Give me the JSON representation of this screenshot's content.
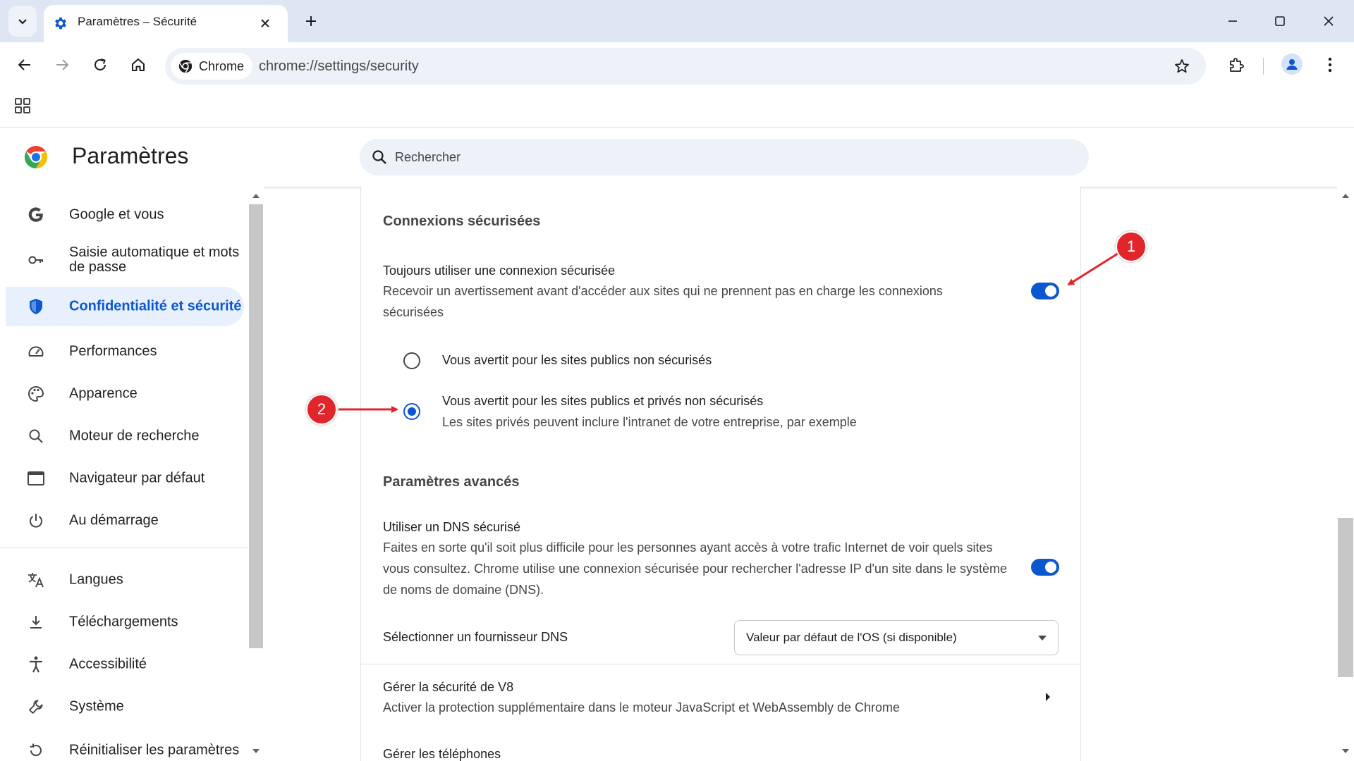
{
  "browser": {
    "tab": {
      "title": "Paramètres – Sécurité",
      "favicon": "gear-icon"
    },
    "omnibox": {
      "chip_label": "Chrome",
      "url": "chrome://settings/security"
    }
  },
  "settings": {
    "title": "Paramètres",
    "search": {
      "placeholder": "Rechercher"
    }
  },
  "sidebar": {
    "items": [
      {
        "label": "Google et vous",
        "icon": "google-g-icon"
      },
      {
        "label": "Saisie automatique et mots de passe",
        "icon": "key-icon"
      },
      {
        "label": "Confidentialité et sécurité",
        "icon": "shield-icon",
        "active": true
      },
      {
        "label": "Performances",
        "icon": "speedometer-icon"
      },
      {
        "label": "Apparence",
        "icon": "palette-icon"
      },
      {
        "label": "Moteur de recherche",
        "icon": "search-icon"
      },
      {
        "label": "Navigateur par défaut",
        "icon": "browser-window-icon"
      },
      {
        "label": "Au démarrage",
        "icon": "power-icon"
      },
      {
        "label": "Langues",
        "icon": "translate-icon"
      },
      {
        "label": "Téléchargements",
        "icon": "download-icon"
      },
      {
        "label": "Accessibilité",
        "icon": "accessibility-icon"
      },
      {
        "label": "Système",
        "icon": "wrench-icon"
      },
      {
        "label": "Réinitialiser les paramètres",
        "icon": "reset-icon"
      }
    ]
  },
  "main": {
    "secure_connections": {
      "heading": "Connexions sécurisées",
      "always_secure": {
        "title": "Toujours utiliser une connexion sécurisée",
        "description": "Recevoir un avertissement avant d'accéder aux sites qui ne prennent pas en charge les connexions sécurisées",
        "enabled": true
      },
      "options": [
        {
          "label": "Vous avertit pour les sites publics non sécurisés",
          "sublabel": "",
          "selected": false
        },
        {
          "label": "Vous avertit pour les sites publics et privés non sécurisés",
          "sublabel": "Les sites privés peuvent inclure l'intranet de votre entreprise, par exemple",
          "selected": true
        }
      ]
    },
    "advanced": {
      "heading": "Paramètres avancés",
      "secure_dns": {
        "title": "Utiliser un DNS sécurisé",
        "description": "Faites en sorte qu'il soit plus difficile pour les personnes ayant accès à votre trafic Internet de voir quels sites vous consultez. Chrome utilise une connexion sécurisée pour rechercher l'adresse IP d'un site dans le système de noms de domaine (DNS).",
        "enabled": true
      },
      "dns_provider": {
        "label": "Sélectionner un fournisseur DNS",
        "selected": "Valeur par défaut de l'OS (si disponible)"
      },
      "v8": {
        "title": "Gérer la sécurité de V8",
        "description": "Activer la protection supplémentaire dans le moteur JavaScript et WebAssembly de Chrome"
      },
      "phones": {
        "title": "Gérer les téléphones"
      }
    }
  },
  "annotations": [
    {
      "number": "1",
      "color": "#e0252b"
    },
    {
      "number": "2",
      "color": "#e0252b"
    }
  ],
  "colors": {
    "accent": "#0b57d0",
    "active_bg": "#e8f0fe",
    "annotation": "#e0252b"
  }
}
